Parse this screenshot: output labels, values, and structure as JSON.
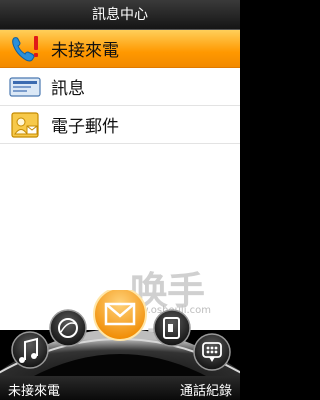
{
  "header": {
    "title": "訊息中心"
  },
  "list": {
    "items": [
      {
        "label": "未接來電",
        "icon": "missed-call-icon",
        "selected": true
      },
      {
        "label": "訊息",
        "icon": "message-icon",
        "selected": false
      },
      {
        "label": "電子郵件",
        "icon": "email-icon",
        "selected": false
      }
    ]
  },
  "watermark": {
    "brand": "唤手机",
    "url": "www.oshouji.com"
  },
  "dock": {
    "icons": [
      "music-icon",
      "browser-globe-icon",
      "mail-icon",
      "phone-book-icon",
      "dialpad-icon"
    ],
    "selected": "mail-icon"
  },
  "softkeys": {
    "left": "未接來電",
    "right": "通話紀錄"
  },
  "colors": {
    "accent": "#ff9800",
    "titlebar": "#1e1e1e"
  }
}
